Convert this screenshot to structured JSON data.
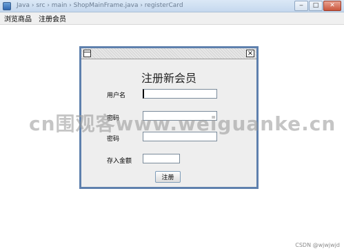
{
  "window": {
    "title": "Java  ›  src  ›  main  ›  ShopMainFrame.java  ›  registerCard"
  },
  "menubar": {
    "items": [
      "浏览商品",
      "注册会员"
    ]
  },
  "dialog": {
    "heading": "注册新会员",
    "close_glyph": "×",
    "fields": [
      {
        "label": "用户名",
        "value": ""
      },
      {
        "label": "密码",
        "value": ""
      },
      {
        "label": "密码",
        "value": ""
      },
      {
        "label": "存入金额",
        "value": ""
      }
    ],
    "submit_label": "注册"
  },
  "overlay": {
    "watermark": "cn围观客www.weiguanke.cn",
    "credit": "CSDN @wjwjwjd"
  },
  "colors": {
    "dialog_border": "#5e80ad",
    "dialog_bg": "#eeeeee"
  }
}
